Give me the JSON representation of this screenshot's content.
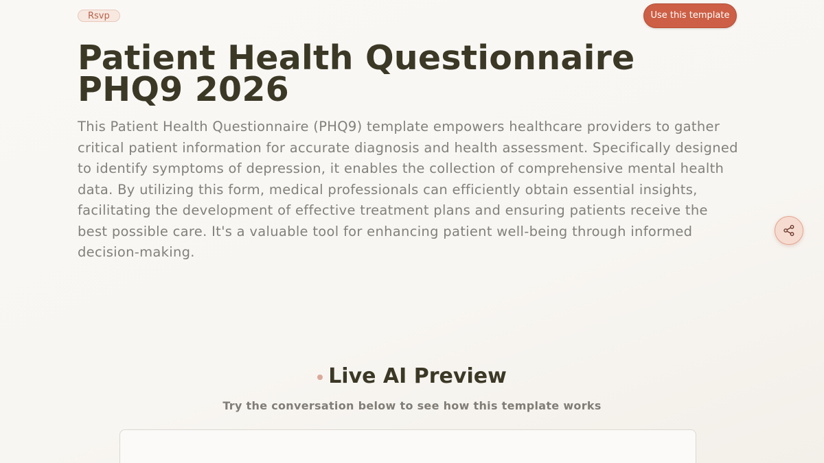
{
  "header": {
    "tag_label": "Rsvp",
    "cta_label": "Use this template"
  },
  "hero": {
    "title": "Patient Health Questionnaire PHQ9 2026",
    "description": "This Patient Health Questionnaire (PHQ9) template empowers healthcare providers to gather critical patient information for accurate diagnosis and health assessment. Specifically designed to identify symptoms of depression, it enables the collection of comprehensive mental health data. By utilizing this form, medical professionals can efficiently obtain essential insights, facilitating the development of effective treatment plans and ensuring patients receive the best possible care. It's a valuable tool for enhancing patient well-being through informed decision-making."
  },
  "share": {
    "icon": "share-icon"
  },
  "preview": {
    "title": "Live AI Preview",
    "subtitle": "Try the conversation below to see how this template works"
  },
  "colors": {
    "accent": "#cc5f45",
    "title_text": "#3b3826",
    "body_text": "#82807a",
    "background": "#f9f7f4"
  }
}
